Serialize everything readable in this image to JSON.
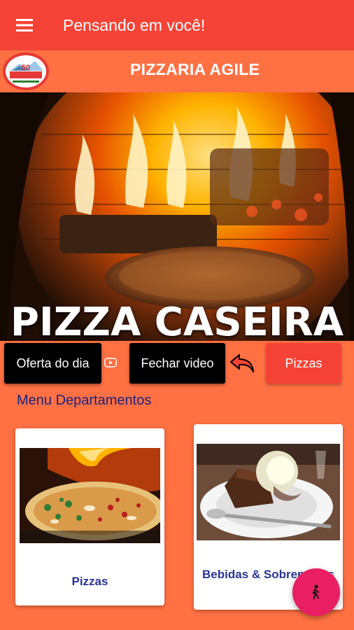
{
  "app_bar": {
    "title": "Pensando em você!",
    "menu_icon": "hamburger-menu-icon"
  },
  "store": {
    "name": "PIZZARIA AGILE",
    "logo_text": "50"
  },
  "video": {
    "caption": "PIZZA CASEIRA"
  },
  "actions": {
    "offer_label": "Oferta do dia",
    "close_video_label": "Fechar video",
    "pizzas_label": "Pizzas",
    "video_icon": "youtube-icon",
    "back_icon": "undo-arrow-icon"
  },
  "menu": {
    "title": "Menu Departamentos",
    "departments": [
      {
        "label": "Pizzas",
        "image": "pizza-photo"
      },
      {
        "label": "Bebidas & Sobremesas",
        "image": "dessert-photo"
      }
    ]
  },
  "fab": {
    "icon": "walking-person-icon"
  },
  "colors": {
    "app_bar": "#f44336",
    "background": "#ff7043",
    "fab": "#e91e63",
    "dept_label": "#283593"
  }
}
